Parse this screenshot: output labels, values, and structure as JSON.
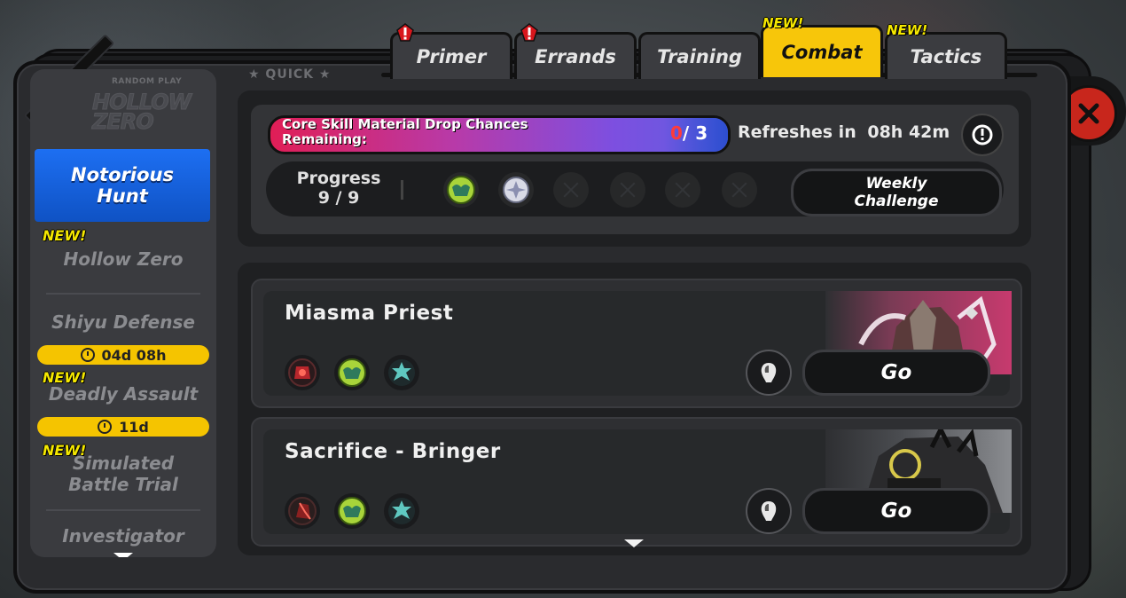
{
  "tabs": [
    {
      "label": "Primer",
      "alert": true
    },
    {
      "label": "Errands",
      "alert": true
    },
    {
      "label": "Training",
      "alert": false
    },
    {
      "label": "Combat",
      "active": true,
      "new_label": "NEW!"
    },
    {
      "label": "Tactics",
      "new_label": "NEW!"
    }
  ],
  "sidebar": {
    "logo_small": "RANDOM PLAY",
    "logo_main": "HOLLOW ZERO",
    "quick_label": "★ QUICK ★",
    "items": [
      {
        "label": "Notorious Hunt",
        "active": true
      },
      {
        "label": "Hollow Zero",
        "new_label": "NEW!"
      },
      {
        "label": "Shiyu Defense",
        "timer": "04d 08h"
      },
      {
        "label": "Deadly Assault",
        "new_label": "NEW!",
        "timer": "11d"
      },
      {
        "label": "Simulated Battle Trial",
        "new_label": "NEW!"
      },
      {
        "label": "Investigator"
      }
    ]
  },
  "drop": {
    "text": "Core Skill Material Drop Chances Remaining:",
    "current": "0",
    "total": "/ 3",
    "refresh_label": "Refreshes in",
    "refresh_time": "08h 42m"
  },
  "progress": {
    "label": "Progress",
    "value": "9 / 9",
    "weekly_button": "Weekly Challenge",
    "slots": [
      "green-material-icon",
      "white-material-icon",
      "empty",
      "empty",
      "empty",
      "empty"
    ]
  },
  "bosses": [
    {
      "name": "Miasma Priest",
      "go_label": "Go",
      "materials": [
        "red-core-icon",
        "green-material-icon",
        "teal-gear-icon"
      ]
    },
    {
      "name": "Sacrifice - Bringer",
      "go_label": "Go",
      "materials": [
        "red-crystal-icon",
        "green-material-icon",
        "teal-gear-icon"
      ]
    }
  ],
  "colors": {
    "accent_yellow": "#f7c60a",
    "active_blue": "#1d6ff2",
    "close_red": "#c8261c"
  }
}
